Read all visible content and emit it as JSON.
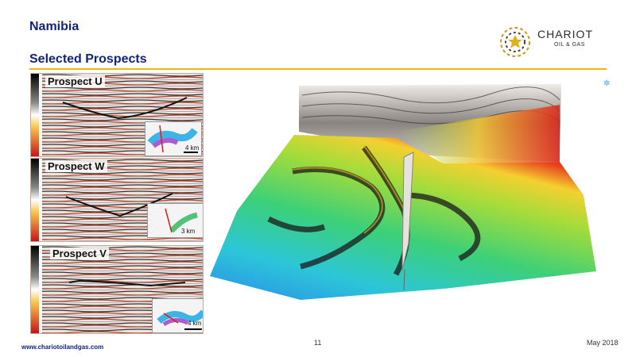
{
  "header": {
    "title": "Namibia",
    "subtitle": "Selected Prospects",
    "accent_color": "#e8b90a",
    "title_color": "#13257a"
  },
  "logo": {
    "name": "CHARIOT",
    "tagline": "OIL & GAS",
    "icon": "star-burst-logo-icon"
  },
  "panels": [
    {
      "label": "Prospect U",
      "scale": "4 km"
    },
    {
      "label": "Prospect W",
      "scale": "3 km"
    },
    {
      "label": "Prospect V",
      "scale": "4 km"
    }
  ],
  "footer": {
    "url": "www.chariotoilandgas.com",
    "page": "11",
    "date": "May 2018"
  }
}
